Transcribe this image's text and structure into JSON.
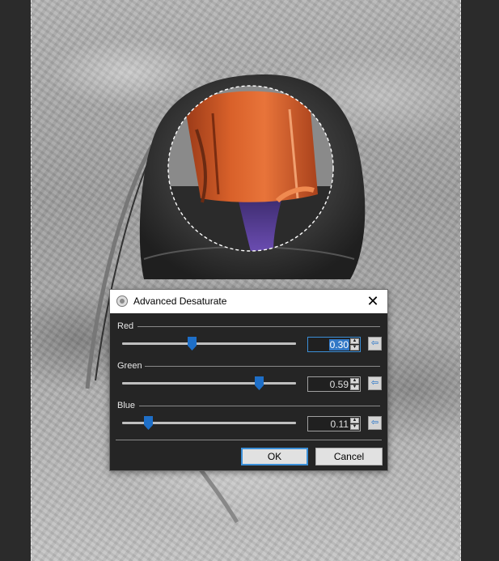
{
  "dialog": {
    "title": "Advanced Desaturate",
    "close_label": "✕",
    "channels": [
      {
        "label": "Red",
        "value": "0.30",
        "level": 0.3
      },
      {
        "label": "Green",
        "value": "0.59",
        "level": 0.59
      },
      {
        "label": "Blue",
        "value": "0.11",
        "level": 0.11
      }
    ],
    "ok_label": "OK",
    "cancel_label": "Cancel"
  },
  "colors": {
    "accent": "#3178c6",
    "slider_thumb": "#1e6fc8",
    "dialog_bg": "#252525",
    "leather": "#d2501e"
  },
  "icons": {
    "title": "dialog-app-icon",
    "close": "close-icon",
    "reset": "reset-arrow-icon"
  }
}
